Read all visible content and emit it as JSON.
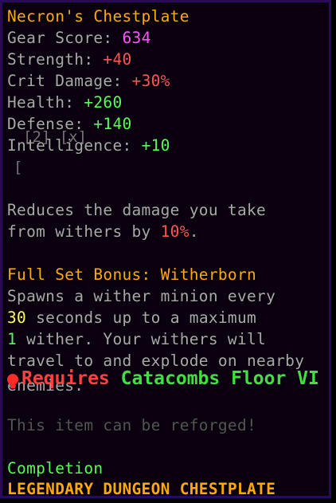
{
  "item": {
    "name": "Necron's Chestplate",
    "stats": [
      {
        "label": "Gear Score: ",
        "value": "634",
        "color": "#ff55ff"
      },
      {
        "label": "Strength: ",
        "value": "+40",
        "color": "#ff5555"
      },
      {
        "label": "Crit Damage: ",
        "value": "+30%",
        "color": "#ff5555"
      },
      {
        "label": "Health: ",
        "value": "+260",
        "color": "#55ff55"
      },
      {
        "label": "Defense: ",
        "value": "+140",
        "color": "#55ff55"
      },
      {
        "label": "Intelligence: ",
        "value": "+10",
        "color": "#55ff55"
      }
    ],
    "overlay_text": "[2] [x]",
    "overlay_bracket": "[",
    "ability": {
      "line1": "Reduces the damage you take",
      "line2_prefix": "from withers by ",
      "line2_value": "10%",
      "line2_suffix": "."
    },
    "set_bonus": {
      "title": "Full Set Bonus: Witherborn",
      "line1": "Spawns a wither minion every",
      "line2_value": "30",
      "line2_suffix": " seconds up to a maximum",
      "line3_value": "1",
      "line3_suffix": " wither. Your withers will",
      "line4": "travel to and explode on nearby",
      "line5": "enemies."
    },
    "requirement": {
      "label": "Requires ",
      "value": "Catacombs Floor VI",
      "icon": "skull-icon"
    },
    "reforge_text": "This item can be reforged!",
    "completion_label": "Completion",
    "rarity_line": "LEGENDARY DUNGEON CHESTPLATE"
  },
  "colors": {
    "background": "#0a000f",
    "border": "#2a0a5c",
    "gold": "#ffaa00",
    "gray": "#a8a8a8",
    "dark_gray": "#545454",
    "pink": "#ff55ff",
    "red": "#ff5555",
    "green": "#55ff55"
  }
}
